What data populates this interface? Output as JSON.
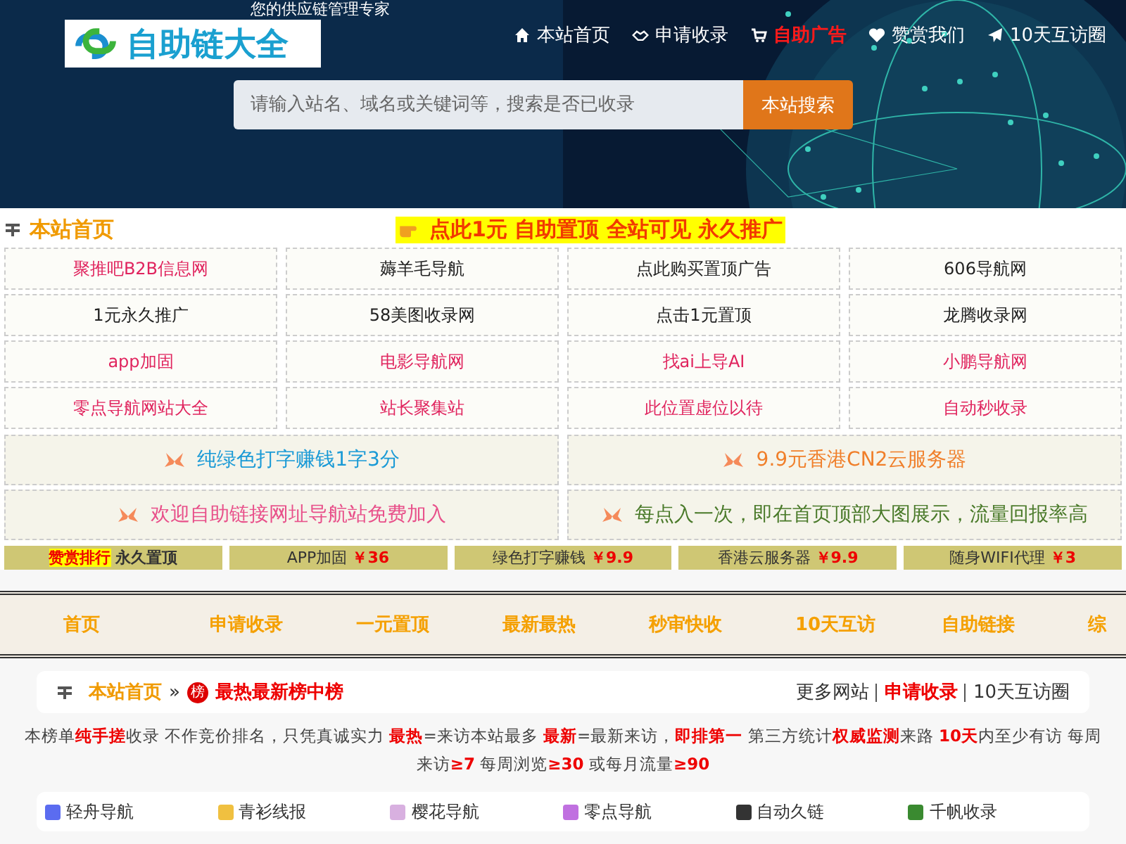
{
  "header": {
    "logo": "自助链大全",
    "tagline": "您的供应链管理专家",
    "nav": [
      {
        "label": "本站首页",
        "highlight": false
      },
      {
        "label": "申请收录",
        "highlight": false
      },
      {
        "label": "自助广告",
        "highlight": true
      },
      {
        "label": "赞赏我们",
        "highlight": false
      },
      {
        "label": "10天互访圈",
        "highlight": false
      }
    ],
    "search": {
      "placeholder": "请输入站名、域名或关键词等，搜索是否已收录",
      "button": "本站搜索"
    }
  },
  "section": {
    "title": "本站首页",
    "promo": "点此1元 自助置顶 全站可见 永久推广",
    "links": [
      {
        "label": "聚推吧B2B信息网",
        "color": "#e0245e"
      },
      {
        "label": "薅羊毛导航",
        "color": "#222222"
      },
      {
        "label": "点此购买置顶广告",
        "color": "#222222"
      },
      {
        "label": "606导航网",
        "color": "#222222"
      },
      {
        "label": "1元永久推广",
        "color": "#222222"
      },
      {
        "label": "58美图收录网",
        "color": "#222222"
      },
      {
        "label": "点击1元置顶",
        "color": "#222222"
      },
      {
        "label": "龙腾收录网",
        "color": "#222222"
      },
      {
        "label": "app加固",
        "color": "#e0245e"
      },
      {
        "label": "电影导航网",
        "color": "#e0245e"
      },
      {
        "label": "找ai上导AI",
        "color": "#e0245e"
      },
      {
        "label": "小鹏导航网",
        "color": "#e0245e"
      },
      {
        "label": "零点导航网站大全",
        "color": "#e0245e"
      },
      {
        "label": "站长聚集站",
        "color": "#e0245e"
      },
      {
        "label": "此位置虚位以待",
        "color": "#e0245e"
      },
      {
        "label": "自动秒收录",
        "color": "#e0245e"
      }
    ],
    "banners": [
      {
        "label": "纯绿色打字赚钱1字3分",
        "color": "#1a9ad6"
      },
      {
        "label": "9.9元香港CN2云服务器",
        "color": "#f07f2a"
      },
      {
        "label": "欢迎自助链接网址导航站免费加入",
        "color": "#e8508a"
      },
      {
        "label": "每点入一次，即在首页顶部大图展示，流量回报率高",
        "color": "#4a7a2a"
      }
    ],
    "ads": [
      {
        "kind": "ranking",
        "tag": "赞赏排行",
        "label": "永久置顶"
      },
      {
        "kind": "price",
        "label": "APP加固",
        "price": "￥36"
      },
      {
        "kind": "price",
        "label": "绿色打字赚钱",
        "price": "￥9.9"
      },
      {
        "kind": "price",
        "label": "香港云服务器",
        "price": "￥9.9"
      },
      {
        "kind": "price",
        "label": "随身WIFI代理",
        "price": "￥3"
      }
    ]
  },
  "menu": [
    "首页",
    "申请收录",
    "一元置顶",
    "最新最热",
    "秒审快收",
    "10天互访",
    "自助链接",
    "综"
  ],
  "breadcrumb": {
    "home": "本站首页",
    "separator": "»",
    "badge": "榜",
    "current": "最热最新榜中榜",
    "links": [
      {
        "label": "更多网站",
        "highlight": false
      },
      {
        "label": "申请收录",
        "highlight": true
      },
      {
        "label": "10天互访圈",
        "highlight": false
      }
    ]
  },
  "notice": "本榜单**纯手搓**收录 不作竞价排名，只凭真诚实力 **最热**=来访本站最多 **最新**=最新来访，**即排第一** 第三方统计**权威监测**来路 **10天**内至少有访 每周来访**≥7** 每周浏览**≥30** 或每月流量**≥90**",
  "sites": [
    {
      "label": "轻舟导航",
      "color": "#5b6cf0"
    },
    {
      "label": "青衫线报",
      "color": "#f0c040"
    },
    {
      "label": "樱花导航",
      "color": "#d8b0e0"
    },
    {
      "label": "零点导航",
      "color": "#c070e0"
    },
    {
      "label": "自动久链",
      "color": "#333333"
    },
    {
      "label": "千帆收录",
      "color": "#3a8a30"
    }
  ]
}
